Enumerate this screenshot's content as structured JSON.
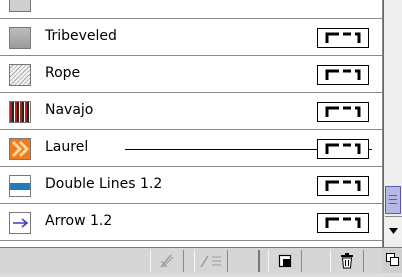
{
  "brushes": [
    {
      "name": "Tribeveled",
      "swatch": "tribeveled-swatch"
    },
    {
      "name": "Rope",
      "swatch": "rope-swatch"
    },
    {
      "name": "Navajo",
      "swatch": "navajo-swatch"
    },
    {
      "name": "Laurel",
      "swatch": "laurel-swatch"
    },
    {
      "name": "Double Lines 1.2",
      "swatch": "double-lines-swatch"
    },
    {
      "name": "Arrow 1.2",
      "swatch": "arrow-swatch"
    }
  ],
  "toolbar": {
    "buttons": [
      {
        "icon": "remove-brush-stroke-icon"
      },
      {
        "icon": "brush-options-icon"
      },
      {
        "icon": "new-brush-icon"
      },
      {
        "icon": "trash-icon"
      }
    ]
  },
  "colors": {
    "accent": "#f07b1f",
    "scroll_thumb": "#b7b8e6",
    "double_line_blue": "#1f7bbf",
    "arrow_blue": "#3b3bc6"
  }
}
